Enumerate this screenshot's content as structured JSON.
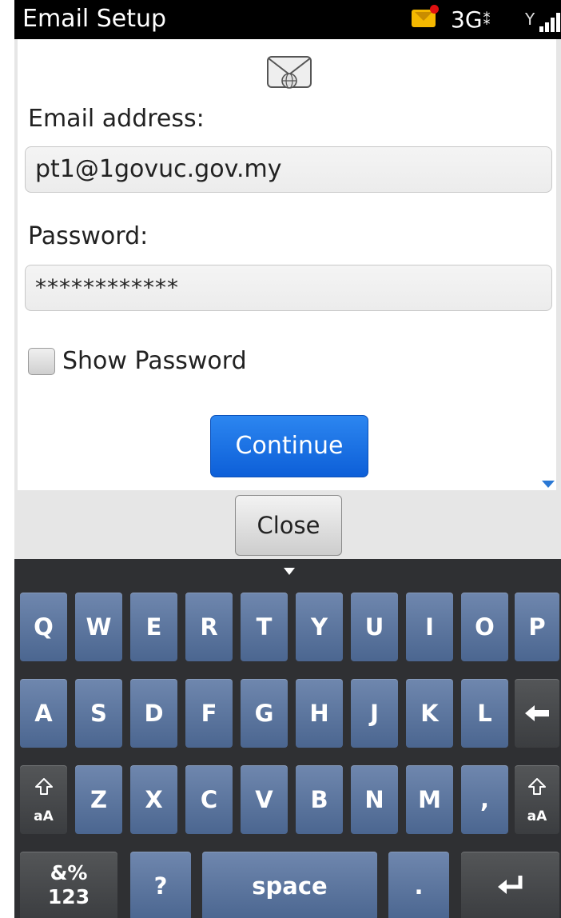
{
  "status_bar": {
    "title": "Email Setup",
    "network": "3G",
    "bb_glyph": "⁑"
  },
  "form": {
    "email_label": "Email address:",
    "email_value": "pt1@1govuc.gov.my",
    "password_label": "Password:",
    "password_value": "************",
    "show_password_label": "Show Password",
    "show_password_checked": false,
    "continue_label": "Continue"
  },
  "close_label": "Close",
  "keyboard": {
    "row1": [
      "Q",
      "W",
      "E",
      "R",
      "T",
      "Y",
      "U",
      "I",
      "O",
      "P"
    ],
    "row2": [
      "A",
      "S",
      "D",
      "F",
      "G",
      "H",
      "J",
      "K",
      "L"
    ],
    "row3": [
      "Z",
      "X",
      "C",
      "V",
      "B",
      "N",
      "M",
      ","
    ],
    "shift_label": "aA",
    "sym_label_top": "&%",
    "sym_label_bottom": "123",
    "question": "?",
    "space": "space",
    "period": "."
  },
  "colors": {
    "accent_blue": "#1a6fe2",
    "key_blue": "#5a7299",
    "key_dark": "#46484b",
    "keyboard_bg": "#2f3033"
  }
}
